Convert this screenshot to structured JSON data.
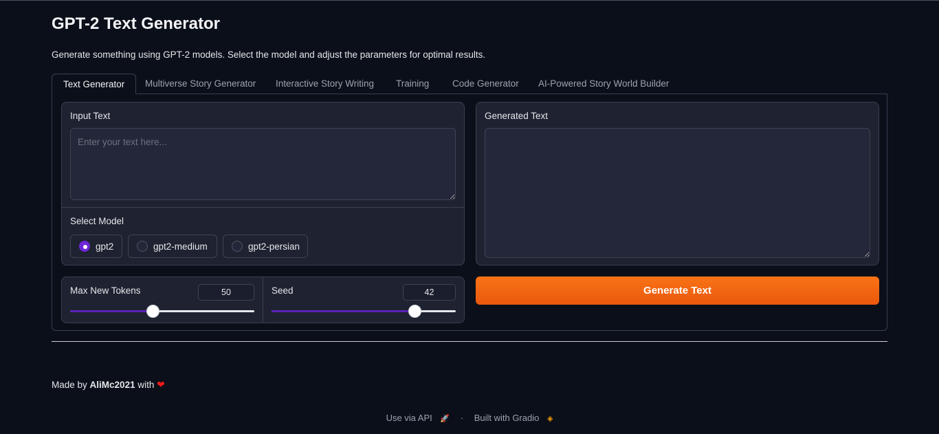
{
  "app": {
    "title": "GPT-2 Text Generator",
    "description": "Generate something using GPT-2 models. Select the model and adjust the parameters for optimal results."
  },
  "tabs": [
    {
      "label": "Text Generator",
      "active": true
    },
    {
      "label": "Multiverse Story Generator"
    },
    {
      "label": "Interactive Story Writing"
    },
    {
      "label": "Training"
    },
    {
      "label": "Code Generator"
    },
    {
      "label": "AI-Powered Story World Builder"
    }
  ],
  "input": {
    "label": "Input Text",
    "placeholder": "Enter your text here...",
    "value": ""
  },
  "model": {
    "label": "Select Model",
    "options": [
      "gpt2",
      "gpt2-medium",
      "gpt2-persian"
    ],
    "selected": "gpt2"
  },
  "sliders": {
    "max_tokens": {
      "label": "Max New Tokens",
      "value": "50",
      "fraction": 0.447
    },
    "seed": {
      "label": "Seed",
      "value": "42",
      "fraction": 0.775
    }
  },
  "output": {
    "label": "Generated Text",
    "value": ""
  },
  "generate_button": "Generate Text",
  "credits": {
    "prefix": "Made by",
    "author": "AliMc2021",
    "suffix": "with",
    "heart": "❤"
  },
  "footer": {
    "api": "Use via API",
    "separator": "·",
    "built": "Built with Gradio"
  },
  "colors": {
    "background": "#0b0f19",
    "accent": "#f97316",
    "slider_fill": "#5b21b6",
    "radio_selected": "#6d28d9"
  }
}
